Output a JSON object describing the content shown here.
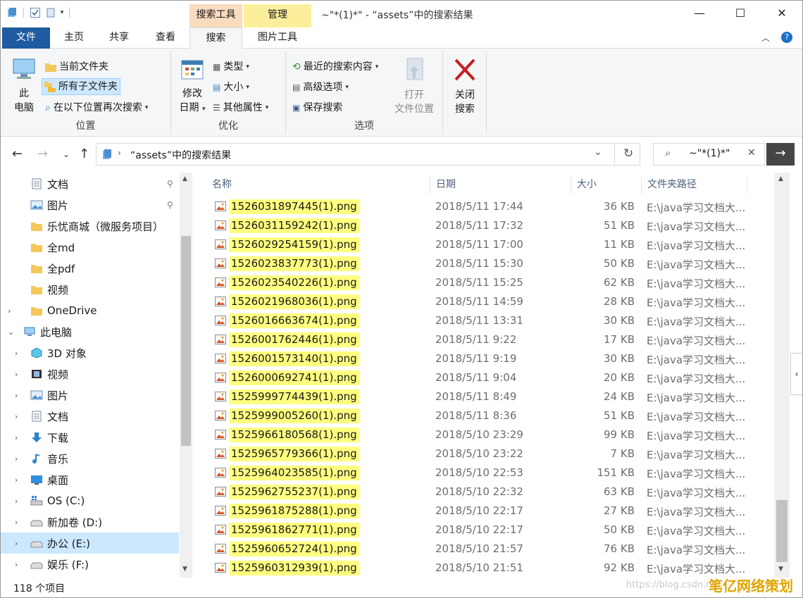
{
  "window": {
    "title": "~\"*(1)*\" - “assets”中的搜索结果",
    "contextual_tabs": [
      "搜索工具",
      "管理"
    ],
    "controls": {
      "minimize": "—",
      "maximize": "☐",
      "close": "✕"
    }
  },
  "tabs": {
    "file": "文件",
    "home": "主页",
    "share": "共享",
    "view": "查看",
    "search": "搜索",
    "picture_tools": "图片工具"
  },
  "ribbon": {
    "location": {
      "label": "位置",
      "this_pc": [
        "此",
        "电脑"
      ],
      "current_folder": "当前文件夹",
      "all_subfolders": "所有子文件夹",
      "search_again": "在以下位置再次搜索"
    },
    "refine": {
      "label": "优化",
      "modified": [
        "修改",
        "日期"
      ],
      "type": "类型",
      "size": "大小",
      "other_props": "其他属性"
    },
    "options": {
      "label": "选项",
      "recent_searches": "最近的搜索内容",
      "advanced": "高级选项",
      "save_search": "保存搜索",
      "open_location": [
        "打开",
        "文件位置"
      ]
    },
    "close": {
      "label": [
        "关闭",
        "搜索"
      ]
    }
  },
  "address": {
    "path": "“assets”中的搜索结果",
    "search_value": "~\"*(1)*\""
  },
  "nav": [
    {
      "label": "文档",
      "icon": "document-icon",
      "indent": 1,
      "pinned": true
    },
    {
      "label": "图片",
      "icon": "pictures-icon",
      "indent": 1,
      "pinned": true
    },
    {
      "label": "乐忧商城（微服务项目）",
      "icon": "folder-icon",
      "indent": 1
    },
    {
      "label": "全md",
      "icon": "folder-icon",
      "indent": 1
    },
    {
      "label": "全pdf",
      "icon": "folder-icon",
      "indent": 1
    },
    {
      "label": "视频",
      "icon": "folder-icon",
      "indent": 1
    },
    {
      "label": "OneDrive",
      "icon": "onedrive-folder-icon",
      "indent": 1,
      "chevron": "›"
    },
    {
      "label": "此电脑",
      "icon": "computer-icon",
      "indent": 0,
      "chevron": "⌄"
    },
    {
      "label": "3D 对象",
      "icon": "3d-objects-icon",
      "indent": 2,
      "chevron": "›"
    },
    {
      "label": "视频",
      "icon": "videos-icon",
      "indent": 2,
      "chevron": "›"
    },
    {
      "label": "图片",
      "icon": "pictures-icon",
      "indent": 2,
      "chevron": "›"
    },
    {
      "label": "文档",
      "icon": "document-icon",
      "indent": 2,
      "chevron": "›"
    },
    {
      "label": "下载",
      "icon": "download-icon",
      "indent": 2,
      "chevron": "›"
    },
    {
      "label": "音乐",
      "icon": "music-icon",
      "indent": 2,
      "chevron": "›"
    },
    {
      "label": "桌面",
      "icon": "desktop-icon",
      "indent": 2,
      "chevron": "›"
    },
    {
      "label": "OS (C:)",
      "icon": "windows-drive-icon",
      "indent": 2,
      "chevron": "›"
    },
    {
      "label": "新加卷 (D:)",
      "icon": "drive-icon",
      "indent": 2,
      "chevron": "›"
    },
    {
      "label": "办公 (E:)",
      "icon": "drive-icon",
      "indent": 2,
      "chevron": "›",
      "selected": true
    },
    {
      "label": "娱乐 (F:)",
      "icon": "drive-icon",
      "indent": 2,
      "chevron": "›"
    }
  ],
  "columns": {
    "name": "名称",
    "date": "日期",
    "size": "大小",
    "path": "文件夹路径"
  },
  "files": [
    {
      "name": "1526031897445(1).png",
      "date": "2018/5/11 17:44",
      "size": "36 KB",
      "path": "E:\\java学习文档大..."
    },
    {
      "name": "1526031159242(1).png",
      "date": "2018/5/11 17:32",
      "size": "51 KB",
      "path": "E:\\java学习文档大..."
    },
    {
      "name": "1526029254159(1).png",
      "date": "2018/5/11 17:00",
      "size": "11 KB",
      "path": "E:\\java学习文档大..."
    },
    {
      "name": "1526023837773(1).png",
      "date": "2018/5/11 15:30",
      "size": "50 KB",
      "path": "E:\\java学习文档大..."
    },
    {
      "name": "1526023540226(1).png",
      "date": "2018/5/11 15:25",
      "size": "62 KB",
      "path": "E:\\java学习文档大..."
    },
    {
      "name": "1526021968036(1).png",
      "date": "2018/5/11 14:59",
      "size": "28 KB",
      "path": "E:\\java学习文档大..."
    },
    {
      "name": "1526016663674(1).png",
      "date": "2018/5/11 13:31",
      "size": "30 KB",
      "path": "E:\\java学习文档大..."
    },
    {
      "name": "1526001762446(1).png",
      "date": "2018/5/11 9:22",
      "size": "17 KB",
      "path": "E:\\java学习文档大..."
    },
    {
      "name": "1526001573140(1).png",
      "date": "2018/5/11 9:19",
      "size": "30 KB",
      "path": "E:\\java学习文档大..."
    },
    {
      "name": "1526000692741(1).png",
      "date": "2018/5/11 9:04",
      "size": "20 KB",
      "path": "E:\\java学习文档大..."
    },
    {
      "name": "1525999774439(1).png",
      "date": "2018/5/11 8:49",
      "size": "24 KB",
      "path": "E:\\java学习文档大..."
    },
    {
      "name": "1525999005260(1).png",
      "date": "2018/5/11 8:36",
      "size": "51 KB",
      "path": "E:\\java学习文档大..."
    },
    {
      "name": "1525966180568(1).png",
      "date": "2018/5/10 23:29",
      "size": "99 KB",
      "path": "E:\\java学习文档大..."
    },
    {
      "name": "1525965779366(1).png",
      "date": "2018/5/10 23:22",
      "size": "7 KB",
      "path": "E:\\java学习文档大..."
    },
    {
      "name": "1525964023585(1).png",
      "date": "2018/5/10 22:53",
      "size": "151 KB",
      "path": "E:\\java学习文档大..."
    },
    {
      "name": "1525962755237(1).png",
      "date": "2018/5/10 22:32",
      "size": "63 KB",
      "path": "E:\\java学习文档大..."
    },
    {
      "name": "1525961875288(1).png",
      "date": "2018/5/10 22:17",
      "size": "27 KB",
      "path": "E:\\java学习文档大..."
    },
    {
      "name": "1525961862771(1).png",
      "date": "2018/5/10 22:17",
      "size": "50 KB",
      "path": "E:\\java学习文档大..."
    },
    {
      "name": "1525960652724(1).png",
      "date": "2018/5/10 21:57",
      "size": "76 KB",
      "path": "E:\\java学习文档大..."
    },
    {
      "name": "1525960312939(1).png",
      "date": "2018/5/10 21:51",
      "size": "92 KB",
      "path": "E:\\java学习文档大..."
    }
  ],
  "status": {
    "count": "118 个项目"
  },
  "watermark": {
    "url": "https://blog.csdn.n",
    "brand": "笔亿网络策划"
  },
  "colors": {
    "highlight": "#ffff80",
    "selection": "#cce8ff",
    "file_tab": "#1e5ba0",
    "search_tools": "#f9dbbd",
    "manage": "#fcef9c"
  }
}
